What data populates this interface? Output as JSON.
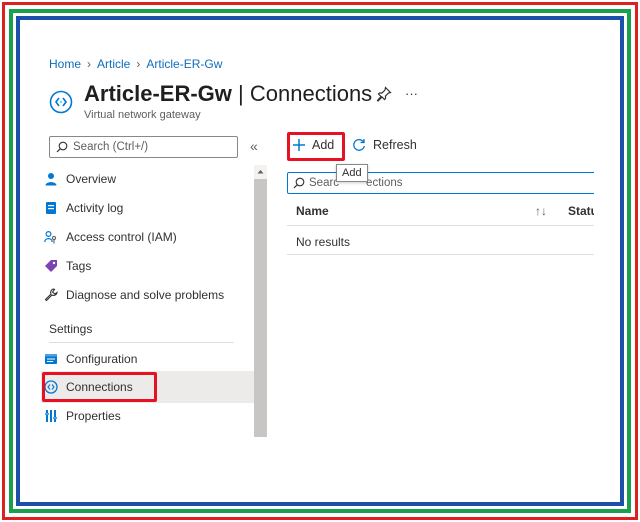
{
  "breadcrumb": {
    "items": [
      "Home",
      "Article",
      "Article-ER-Gw"
    ]
  },
  "header": {
    "resource_name": "Article-ER-Gw",
    "separator": " | ",
    "page_name": "Connections",
    "subtitle": "Virtual network gateway",
    "more_label": "···"
  },
  "sidebar": {
    "search_placeholder": "Search (Ctrl+/)",
    "collapse_label": "«",
    "items": [
      {
        "label": "Overview",
        "icon": "overview-icon"
      },
      {
        "label": "Activity log",
        "icon": "activity-log-icon"
      },
      {
        "label": "Access control (IAM)",
        "icon": "iam-icon"
      },
      {
        "label": "Tags",
        "icon": "tag-icon"
      },
      {
        "label": "Diagnose and solve problems",
        "icon": "wrench-icon"
      }
    ],
    "section_settings": "Settings",
    "settings_items": [
      {
        "label": "Configuration",
        "icon": "configuration-icon"
      },
      {
        "label": "Connections",
        "icon": "connections-icon",
        "selected": true
      },
      {
        "label": "Properties",
        "icon": "properties-icon"
      }
    ]
  },
  "toolbar": {
    "add_label": "Add",
    "refresh_label": "Refresh"
  },
  "tooltip": {
    "text": "Add"
  },
  "main": {
    "search_left": "Searc",
    "search_right": "ections",
    "columns": {
      "name": "Name",
      "sort_glyph": "↑↓",
      "status": "Statu"
    },
    "empty_text": "No results"
  },
  "colors": {
    "link": "#0f6cbd",
    "highlight_border": "#e81123",
    "selected_bg": "#edebe9",
    "accent": "#0078d4"
  }
}
